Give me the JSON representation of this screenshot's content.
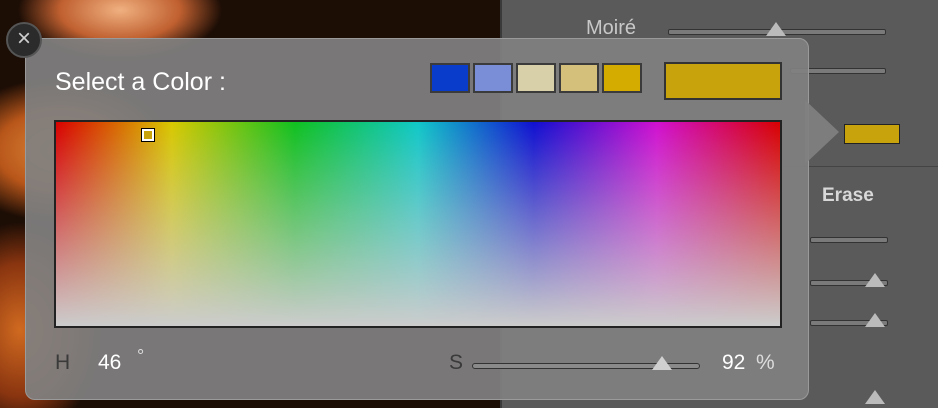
{
  "popup": {
    "title": "Select a Color :",
    "close_glyph": "×",
    "presets": [
      {
        "color": "#0a3ccc"
      },
      {
        "color": "#7a8ed8"
      },
      {
        "color": "#d8d0a8"
      },
      {
        "color": "#d4c07a"
      },
      {
        "color": "#d4ac00"
      }
    ],
    "current_color": "#c9a30c",
    "hue": {
      "label": "H",
      "value": "46",
      "unit": "°"
    },
    "saturation": {
      "label": "S",
      "value": "92",
      "unit": "%",
      "level": 0.92
    }
  },
  "background_panel": {
    "moire_label": "Moiré",
    "erase_label": "Erase",
    "swatch_color": "#c9a30c"
  }
}
